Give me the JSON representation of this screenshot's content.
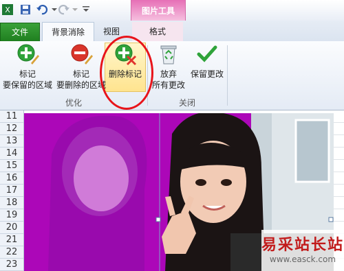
{
  "contextual_tab_group": "图片工具",
  "tabs": {
    "file": "文件",
    "remove_bg": "背景消除",
    "view": "视图",
    "format": "格式"
  },
  "ribbon": {
    "mark_keep": [
      "标记",
      "要保留的区域"
    ],
    "mark_remove": [
      "标记",
      "要删除的区域"
    ],
    "delete_mark": "删除标记",
    "discard": [
      "放弃",
      "所有更改"
    ],
    "keep_changes": "保留更改",
    "group_refine": "优化",
    "group_close": "关闭"
  },
  "row_numbers": [
    "11",
    "12",
    "13",
    "14",
    "15",
    "16",
    "17",
    "18",
    "19",
    "20",
    "21",
    "22",
    "23"
  ],
  "watermark": {
    "title": "易采站长站",
    "url": "www.easck.com"
  }
}
